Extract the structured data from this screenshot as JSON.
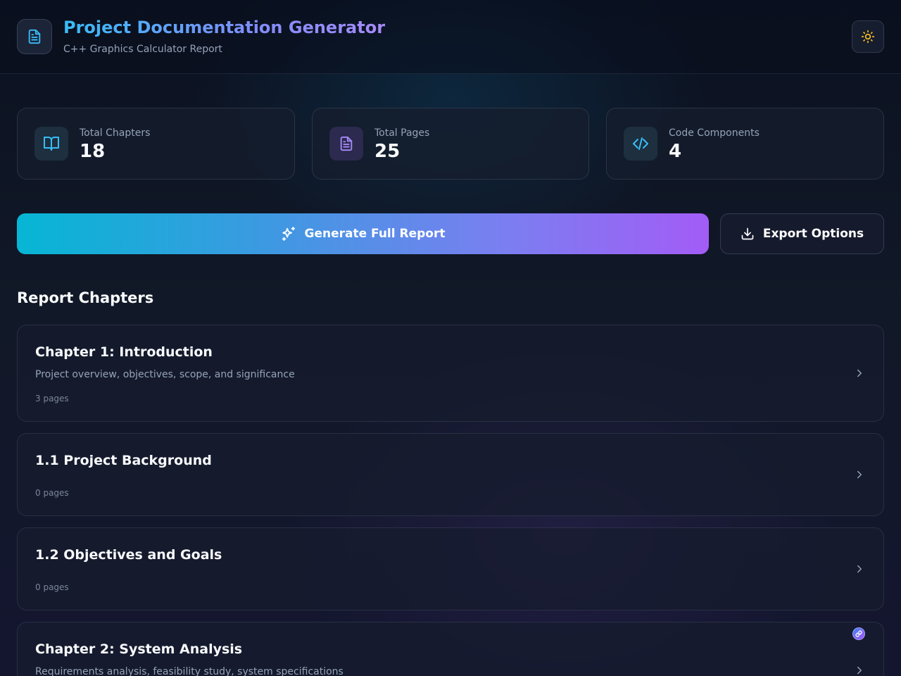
{
  "header": {
    "title": "Project Documentation Generator",
    "subtitle": "C++ Graphics Calculator Report",
    "logo_icon": "document-icon",
    "theme_toggle_icon": "sun-icon"
  },
  "stats": [
    {
      "label": "Total Chapters",
      "value": "18",
      "icon": "book-open-icon"
    },
    {
      "label": "Total Pages",
      "value": "25",
      "icon": "document-icon"
    },
    {
      "label": "Code Components",
      "value": "4",
      "icon": "code-icon"
    }
  ],
  "actions": {
    "generate_label": "Generate Full Report",
    "generate_icon": "sparkles-icon",
    "export_label": "Export Options",
    "export_icon": "download-icon"
  },
  "section_title": "Report Chapters",
  "chapters": [
    {
      "title": "Chapter 1: Introduction",
      "description": "Project overview, objectives, scope, and significance",
      "pages": "3 pages"
    },
    {
      "title": "1.1 Project Background",
      "description": "",
      "pages": "0 pages"
    },
    {
      "title": "1.2 Objectives and Goals",
      "description": "",
      "pages": "0 pages"
    },
    {
      "title": "Chapter 2: System Analysis",
      "description": "Requirements analysis, feasibility study, system specifications",
      "pages": ""
    }
  ],
  "colors": {
    "accent_cyan": "#06b6d4",
    "accent_purple": "#a855f7",
    "sun_icon": "#fbbf24",
    "background": "#0f172a"
  }
}
